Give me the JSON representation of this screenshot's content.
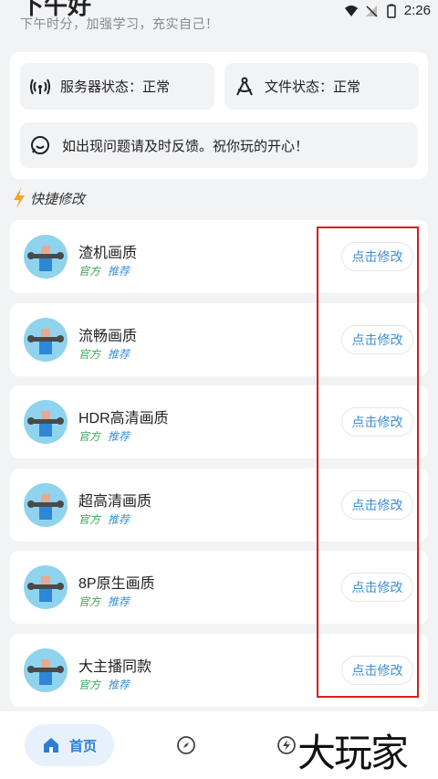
{
  "status_bar": {
    "time": "2:26"
  },
  "header": {
    "greeting": "下午好",
    "subtitle": "下午时分，加强学习，充实自己！"
  },
  "info": {
    "server_status": "服务器状态：正常",
    "file_status": "文件状态：正常",
    "feedback": "如出现问题请及时反馈。祝你玩的开心！"
  },
  "section": {
    "title": "快捷修改"
  },
  "presets": [
    {
      "name": "渣机画质",
      "tag_official": "官方",
      "tag_recommend": "推荐",
      "button": "点击修改"
    },
    {
      "name": "流畅画质",
      "tag_official": "官方",
      "tag_recommend": "推荐",
      "button": "点击修改"
    },
    {
      "name": "HDR高清画质",
      "tag_official": "官方",
      "tag_recommend": "推荐",
      "button": "点击修改"
    },
    {
      "name": "超高清画质",
      "tag_official": "官方",
      "tag_recommend": "推荐",
      "button": "点击修改"
    },
    {
      "name": "8P原生画质",
      "tag_official": "官方",
      "tag_recommend": "推荐",
      "button": "点击修改"
    },
    {
      "name": "大主播同款",
      "tag_official": "官方",
      "tag_recommend": "推荐",
      "button": "点击修改"
    }
  ],
  "nav": {
    "home_label": "首页",
    "items": [
      "home-icon",
      "compass-icon",
      "lightning-icon"
    ]
  },
  "watermark": "大玩家",
  "colors": {
    "accent": "#3a8fd8",
    "official": "#3aa655",
    "highlight": "#d81e1e",
    "background": "#f2f3f5"
  }
}
